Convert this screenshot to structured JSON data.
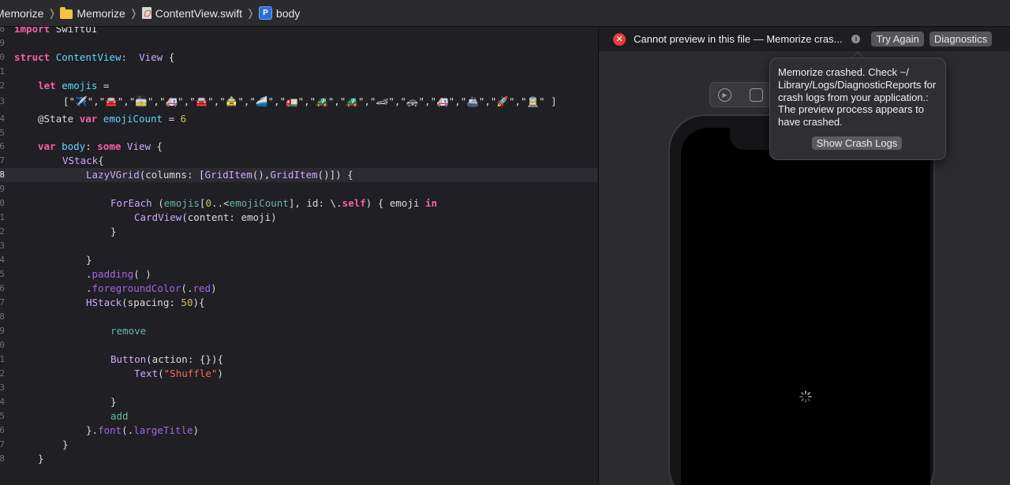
{
  "breadcrumb": {
    "project": "Memorize",
    "group": "Memorize",
    "file": "ContentView.swift",
    "symbol_badge": "P",
    "symbol": "body"
  },
  "editor": {
    "gutter": [
      "8",
      "9",
      "0",
      "1",
      "2",
      "3",
      "4",
      "5",
      "6",
      "7",
      "8",
      "9",
      "0",
      "1",
      "2",
      "3",
      "4",
      "5",
      "6",
      "7",
      "8",
      "9",
      "0",
      "1",
      "2",
      "3",
      "4",
      "5",
      "6",
      "7",
      "8"
    ],
    "lines": {
      "import": "import SwiftUI",
      "emojis_array": "[\"✈️\",\"🚘\",\"🚋\",\"🚑\",\"🚘\",\"🚖\",\"🚄\",\"🚛\",\"🚜\",\"🚜\",\"🏎\",\"🚓\",\"🚑\",\"🚢\",\"🚀\",\"🚊\" ]",
      "remove": "remove",
      "add": "add"
    }
  },
  "preview": {
    "error_message": "Cannot preview in this file — Memorize cras...",
    "try_again_label": "Try Again",
    "diagnostics_label": "Diagnostics",
    "popover_text": "Memorize crashed. Check ~/ Library/Logs/DiagnosticReports for crash logs from your application.: The preview process appears to have crashed.",
    "show_crash_logs_label": "Show Crash Logs"
  },
  "colors": {
    "keyword": "#fc5fa3",
    "type": "#5dd8ff",
    "string": "#fc6a5d",
    "number": "#d0bf69",
    "error": "#e0403a"
  }
}
